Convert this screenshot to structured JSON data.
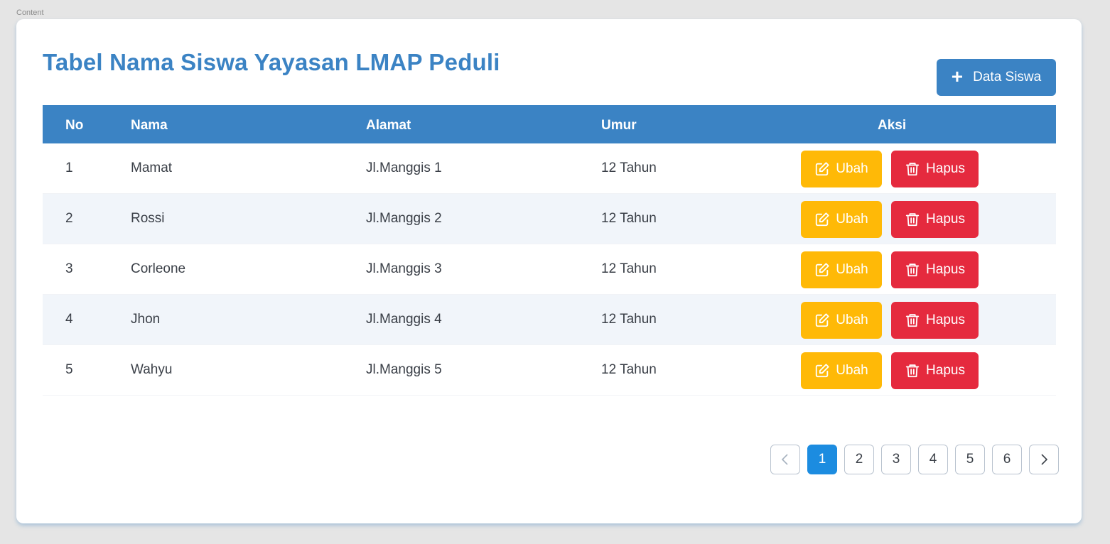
{
  "frame_label": "Content",
  "title": "Tabel Nama Siswa Yayasan LMAP Peduli",
  "add_button": {
    "icon": "plus-icon",
    "label": "Data Siswa"
  },
  "table": {
    "headers": {
      "no": "No",
      "nama": "Nama",
      "alamat": "Alamat",
      "umur": "Umur",
      "aksi": "Aksi"
    },
    "rows": [
      {
        "no": "1",
        "nama": "Mamat",
        "alamat": "Jl.Manggis 1",
        "umur": "12 Tahun"
      },
      {
        "no": "2",
        "nama": "Rossi",
        "alamat": "Jl.Manggis 2",
        "umur": "12 Tahun"
      },
      {
        "no": "3",
        "nama": "Corleone",
        "alamat": "Jl.Manggis 3",
        "umur": "12 Tahun"
      },
      {
        "no": "4",
        "nama": "Jhon",
        "alamat": "Jl.Manggis 4",
        "umur": "12 Tahun"
      },
      {
        "no": "5",
        "nama": "Wahyu",
        "alamat": "Jl.Manggis 5",
        "umur": "12 Tahun"
      }
    ],
    "edit_label": "Ubah",
    "delete_label": "Hapus"
  },
  "pagination": {
    "pages": [
      "1",
      "2",
      "3",
      "4",
      "5",
      "6"
    ],
    "active": "1"
  },
  "colors": {
    "primary": "#3b83c4",
    "edit": "#ffb907",
    "delete": "#e52a3e",
    "page_active": "#1c8ce0"
  }
}
